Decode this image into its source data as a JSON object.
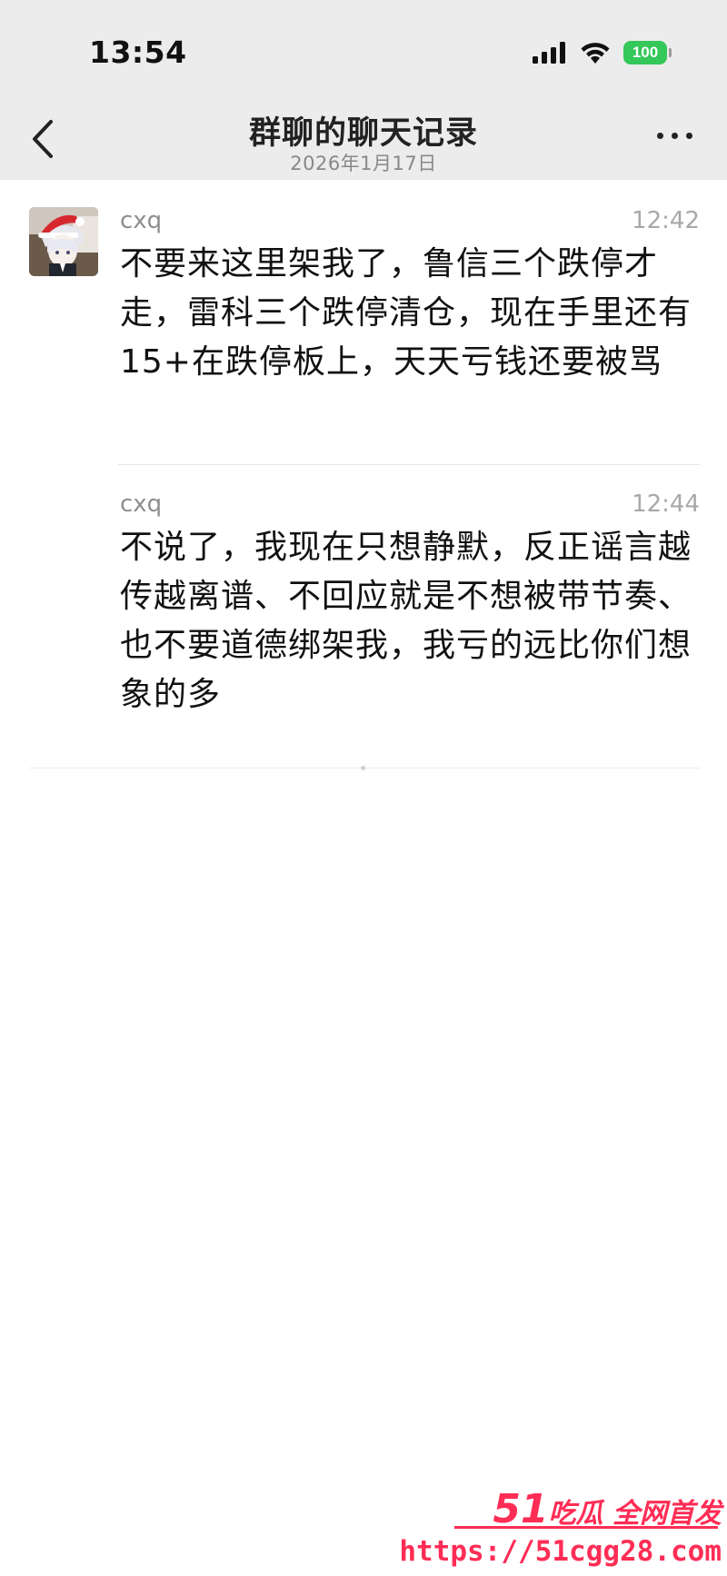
{
  "status_bar": {
    "time": "13:54",
    "battery": "100"
  },
  "nav": {
    "title": "群聊的聊天记录",
    "subtitle": "2026年1月17日"
  },
  "messages": [
    {
      "sender": "cxq",
      "time": "12:42",
      "text": "不要来这里架我了，鲁信三个跌停才走，雷科三个跌停清仓，现在手里还有15+在跌停板上，天天亏钱还要被骂"
    },
    {
      "sender": "cxq",
      "time": "12:44",
      "text": "不说了，我现在只想静默，反正谣言越传越离谱、不回应就是不想被带节奏、也不要道德绑架我，我亏的远比你们想象的多"
    }
  ],
  "watermark": {
    "line1_number": "51",
    "line1_text": "吃瓜 全网首发",
    "line2": "https://51cgg28.com"
  },
  "icons": {
    "back": "chevron-left-icon",
    "more": "more-dots-icon",
    "signal": "signal-icon",
    "wifi": "wifi-icon",
    "battery": "battery-icon"
  },
  "colors": {
    "header_bg": "#ececec",
    "battery": "#34c759",
    "watermark": "#ff2d55"
  }
}
